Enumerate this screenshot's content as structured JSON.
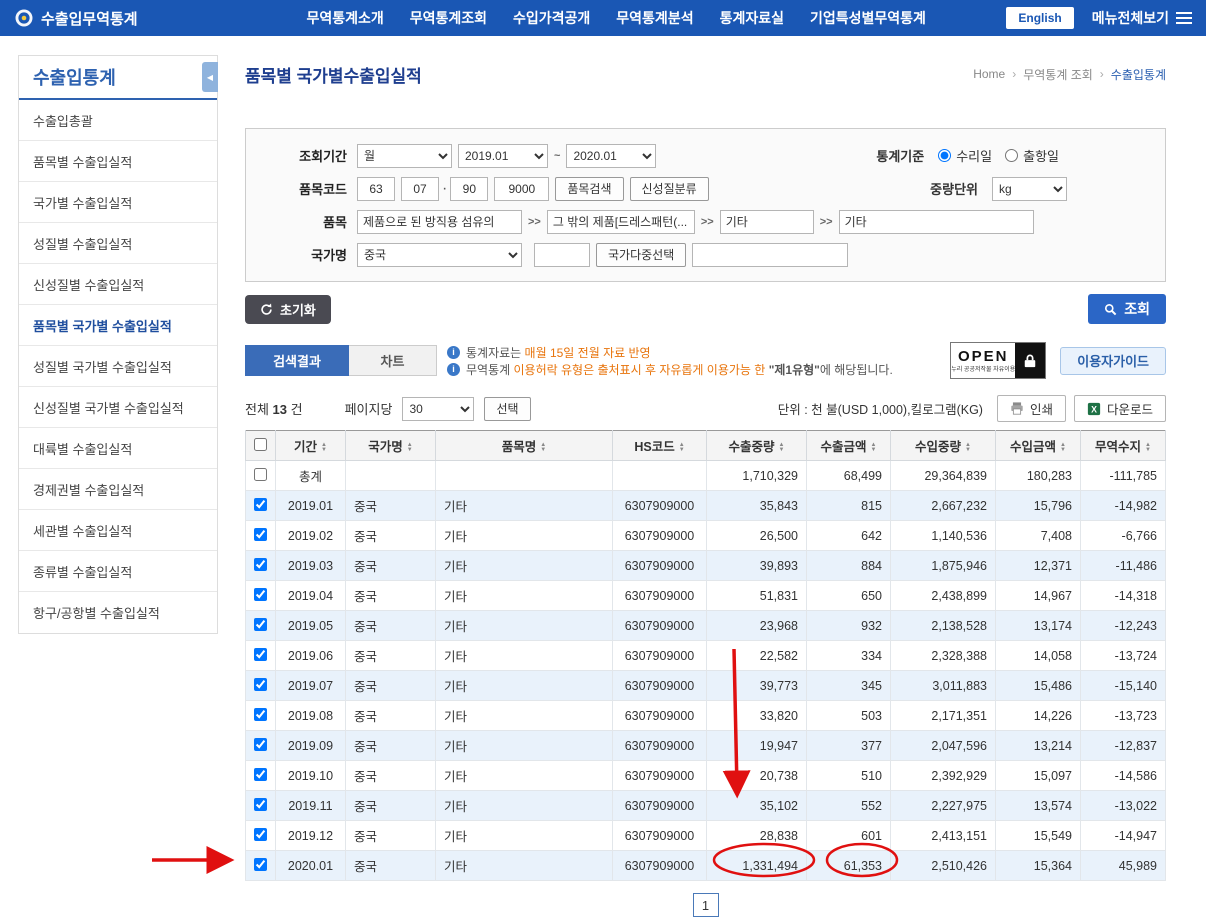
{
  "topnav": {
    "logo_title": "수출입무역통계",
    "items": [
      "무역통계소개",
      "무역통계조회",
      "수입가격공개",
      "무역통계분석",
      "통계자료실",
      "기업특성별무역통계"
    ],
    "english": "English",
    "menu_all": "메뉴전체보기"
  },
  "sidebar": {
    "title": "수출입통계",
    "collapse_glyph": "◀",
    "active_index": 5,
    "items": [
      "수출입총괄",
      "품목별 수출입실적",
      "국가별 수출입실적",
      "성질별 수출입실적",
      "신성질별 수출입실적",
      "품목별 국가별 수출입실적",
      "성질별 국가별 수출입실적",
      "신성질별 국가별 수출입실적",
      "대륙별 수출입실적",
      "경제권별 수출입실적",
      "세관별 수출입실적",
      "종류별 수출입실적",
      "항구/공항별 수출입실적"
    ]
  },
  "page": {
    "title": "품목별 국가별수출입실적",
    "breadcrumb": [
      "Home",
      "무역통계 조회",
      "수출입통계"
    ],
    "breadcrumb_sep": "›"
  },
  "form": {
    "period_label": "조회기간",
    "period_unit": "월",
    "period_from": "2019.01",
    "tilde": "~",
    "period_to": "2020.01",
    "stat_basis_label": "통계기준",
    "stat_basis_options": [
      "수리일",
      "출항일"
    ],
    "item_code_label": "품목코드",
    "item_code_parts": [
      "63",
      "07",
      "90",
      "9000"
    ],
    "item_code_dot": "·",
    "item_search_button": "품목검색",
    "new_class_button": "신성질분류",
    "weight_unit_label": "중량단위",
    "weight_unit": "kg",
    "item_label": "품목",
    "chevron": ">>",
    "item_values": [
      "제품으로 된 방직용 섬유의",
      "그 밖의 제품[드레스패턴(...",
      "기타",
      "기타"
    ],
    "country_label": "국가명",
    "country_value": "중국",
    "country_multi_button": "국가다중선택"
  },
  "actions": {
    "reset_button": "초기화",
    "search_button": "조회"
  },
  "tabs": {
    "results": "검색결과",
    "chart": "차트"
  },
  "notices": {
    "line1_prefix": "통계자료는 ",
    "line1_highlight": "매월 15일 전월 자료 반영",
    "line2_prefix": "무역통계 ",
    "line2_highlight": "이용허락 유형은 출처표시 후 자유롭게 이용가능 한 ",
    "line2_strong": "\"제1유형\"",
    "line2_suffix": "에 해당됩니다."
  },
  "open_license": {
    "open": "OPEN",
    "caption": "공공누리 공공저작물 자유이용허락"
  },
  "guide_button": "이용자가이드",
  "result_bar": {
    "total_prefix": "전체 ",
    "total_count": "13",
    "total_suffix": " 건",
    "per_page_label": "페이지당",
    "per_page_value": "30",
    "select_button": "선택",
    "unit_text": "단위 : 천 불(USD 1,000),킬로그램(KG)",
    "print_button": "인쇄",
    "download_button": "다운로드"
  },
  "table": {
    "columns": [
      "기간",
      "국가명",
      "품목명",
      "HS코드",
      "수출중량",
      "수출금액",
      "수입중량",
      "수입금액",
      "무역수지"
    ],
    "total_row": {
      "label": "총계",
      "values": [
        "1,710,329",
        "68,499",
        "29,364,839",
        "180,283",
        "-111,785"
      ]
    },
    "rows": [
      {
        "checked": true,
        "period": "2019.01",
        "country": "중국",
        "item": "기타",
        "hs": "6307909000",
        "values": [
          "35,843",
          "815",
          "2,667,232",
          "15,796",
          "-14,982"
        ]
      },
      {
        "checked": true,
        "period": "2019.02",
        "country": "중국",
        "item": "기타",
        "hs": "6307909000",
        "values": [
          "26,500",
          "642",
          "1,140,536",
          "7,408",
          "-6,766"
        ]
      },
      {
        "checked": true,
        "period": "2019.03",
        "country": "중국",
        "item": "기타",
        "hs": "6307909000",
        "values": [
          "39,893",
          "884",
          "1,875,946",
          "12,371",
          "-11,486"
        ]
      },
      {
        "checked": true,
        "period": "2019.04",
        "country": "중국",
        "item": "기타",
        "hs": "6307909000",
        "values": [
          "51,831",
          "650",
          "2,438,899",
          "14,967",
          "-14,318"
        ]
      },
      {
        "checked": true,
        "period": "2019.05",
        "country": "중국",
        "item": "기타",
        "hs": "6307909000",
        "values": [
          "23,968",
          "932",
          "2,138,528",
          "13,174",
          "-12,243"
        ]
      },
      {
        "checked": true,
        "period": "2019.06",
        "country": "중국",
        "item": "기타",
        "hs": "6307909000",
        "values": [
          "22,582",
          "334",
          "2,328,388",
          "14,058",
          "-13,724"
        ]
      },
      {
        "checked": true,
        "period": "2019.07",
        "country": "중국",
        "item": "기타",
        "hs": "6307909000",
        "values": [
          "39,773",
          "345",
          "3,011,883",
          "15,486",
          "-15,140"
        ]
      },
      {
        "checked": true,
        "period": "2019.08",
        "country": "중국",
        "item": "기타",
        "hs": "6307909000",
        "values": [
          "33,820",
          "503",
          "2,171,351",
          "14,226",
          "-13,723"
        ]
      },
      {
        "checked": true,
        "period": "2019.09",
        "country": "중국",
        "item": "기타",
        "hs": "6307909000",
        "values": [
          "19,947",
          "377",
          "2,047,596",
          "13,214",
          "-12,837"
        ]
      },
      {
        "checked": true,
        "period": "2019.10",
        "country": "중국",
        "item": "기타",
        "hs": "6307909000",
        "values": [
          "20,738",
          "510",
          "2,392,929",
          "15,097",
          "-14,586"
        ]
      },
      {
        "checked": true,
        "period": "2019.11",
        "country": "중국",
        "item": "기타",
        "hs": "6307909000",
        "values": [
          "35,102",
          "552",
          "2,227,975",
          "13,574",
          "-13,022"
        ]
      },
      {
        "checked": true,
        "period": "2019.12",
        "country": "중국",
        "item": "기타",
        "hs": "6307909000",
        "values": [
          "28,838",
          "601",
          "2,413,151",
          "15,549",
          "-14,947"
        ]
      },
      {
        "checked": true,
        "period": "2020.01",
        "country": "중국",
        "item": "기타",
        "hs": "6307909000",
        "values": [
          "1,331,494",
          "61,353",
          "2,510,426",
          "15,364",
          "45,989"
        ]
      }
    ]
  },
  "pagination": {
    "current": "1"
  },
  "annotations": {
    "color": "#e01010"
  }
}
